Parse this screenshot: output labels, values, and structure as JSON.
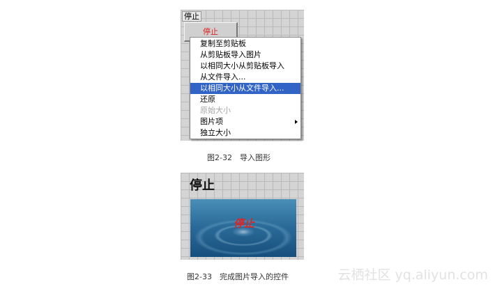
{
  "figure1": {
    "control_label": "停止",
    "button_label": "停止",
    "menu_items": [
      {
        "label": "复制至剪贴板"
      },
      {
        "label": "从剪贴板导入图片"
      },
      {
        "label": "以相同大小从剪贴板导入"
      },
      {
        "label": "从文件导入..."
      },
      {
        "label": "以相同大小从文件导入...",
        "state": "highlighted"
      },
      {
        "label": "还原"
      },
      {
        "label": "原始大小",
        "state": "disabled"
      },
      {
        "label": "图片项",
        "submenu": true
      },
      {
        "label": "独立大小"
      }
    ],
    "caption": "图2-32　导入图形"
  },
  "figure2": {
    "control_label": "停止",
    "image_text": "停止",
    "caption": "图2-33　完成图片导入的控件"
  },
  "watermark": "云栖社区 yq.aliyun.com",
  "colors": {
    "highlight": "#3264c8",
    "button_text": "#e02020",
    "panel_grid": "#d4d4d4"
  }
}
